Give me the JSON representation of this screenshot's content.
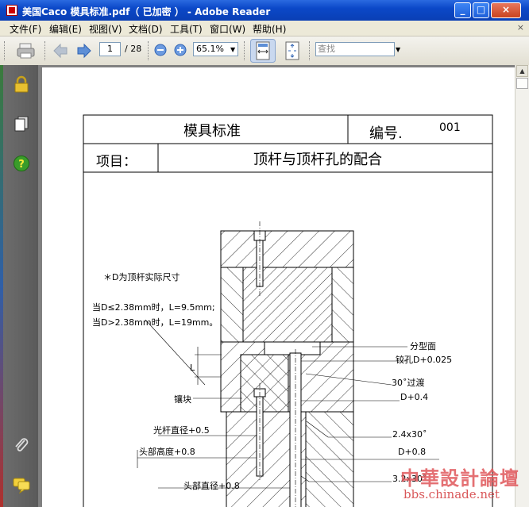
{
  "window": {
    "title": "美国Caco 模具标准.pdf（ 已加密 ） - Adobe Reader",
    "minimize": "_",
    "maximize": "□",
    "close": "×"
  },
  "menu": [
    "文件(F)",
    "编辑(E)",
    "视图(V)",
    "文档(D)",
    "工具(T)",
    "窗口(W)",
    "帮助(H)"
  ],
  "mdi_close": "×",
  "toolbar": {
    "page_current": "1",
    "page_total": "/ 28",
    "zoom": "65.1%",
    "find_placeholder": "查找"
  },
  "nav_icons": [
    "lock-icon",
    "pages-icon",
    "help-icon",
    "attachment-icon",
    "comment-icon"
  ],
  "document": {
    "header_title": "模具标准",
    "header_number_label": "编号.",
    "header_number": "001",
    "item_label": "项目：",
    "item_value": "顶杆与顶杆孔的配合",
    "note1": "＊D为顶杆实际尺寸",
    "note2": "当D≤2.38mm时，L=9.5mm;",
    "note3": "当D>2.38mm时，L=19mm。",
    "labels": {
      "parting": "分型面",
      "ream": "铰孔D+0.025",
      "transition": "30˚过渡",
      "d04": "D+0.4",
      "insert": "镶块",
      "shank": "光杆直径+0.5",
      "chamfer24": "2.4x30˚",
      "head_height": "头部高度+0.8",
      "d08": "D+0.8",
      "head_dia": "头部直径+0.8",
      "chamfer32": "3.2x30˚",
      "L": "L"
    }
  },
  "watermark": {
    "line1": "中華設計論壇",
    "line2": "bbs.chinade.net"
  }
}
